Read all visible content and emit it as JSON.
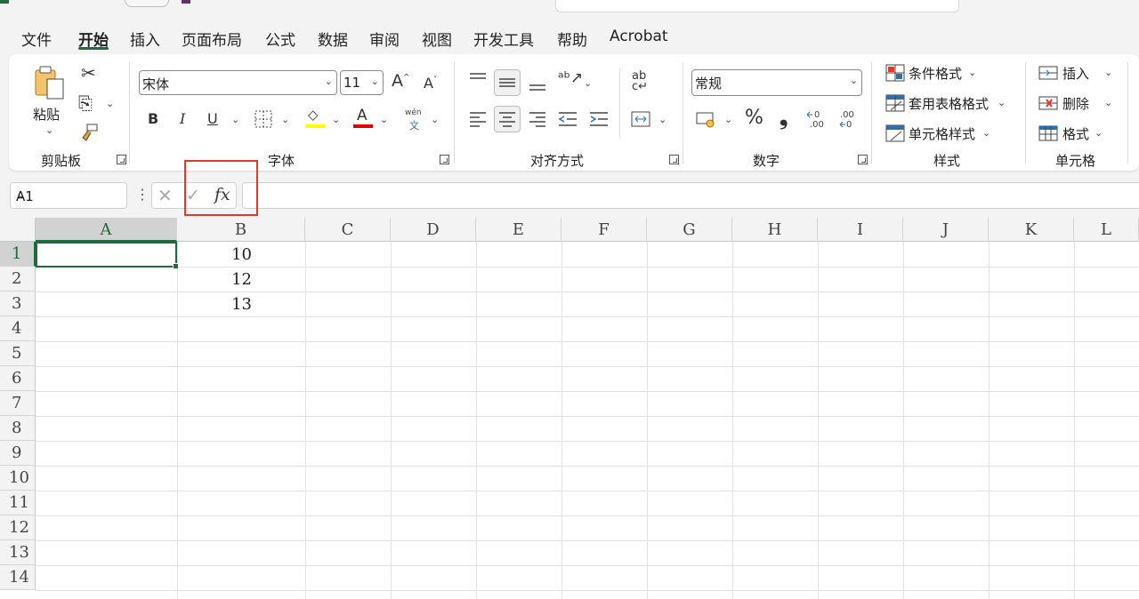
{
  "menu": {
    "tabs": [
      "文件",
      "开始",
      "插入",
      "页面布局",
      "公式",
      "数据",
      "审阅",
      "视图",
      "开发工具",
      "帮助",
      "Acrobat"
    ],
    "active": "开始"
  },
  "ribbon": {
    "clipboard": {
      "paste_label": "粘贴",
      "group_label": "剪贴板"
    },
    "font": {
      "font_name": "宋体",
      "font_size": "11",
      "group_label": "字体",
      "bold": "B",
      "italic": "I",
      "underline": "U",
      "phonetic_top": "wén",
      "phonetic_bottom": "文"
    },
    "alignment": {
      "group_label": "对齐方式"
    },
    "number": {
      "format": "常规",
      "group_label": "数字",
      "percent": "%",
      "comma": "9",
      "inc_decimal": "←0\n.00",
      "dec_decimal": ".00\n→0"
    },
    "styles": {
      "conditional": "条件格式",
      "table": "套用表格格式",
      "cell_styles": "单元格样式",
      "group_label": "样式"
    },
    "cells": {
      "insert": "插入",
      "delete": "删除",
      "format": "格式",
      "group_label": "单元格"
    }
  },
  "formula_bar": {
    "name_box": "A1",
    "fx": "fx",
    "formula": ""
  },
  "sheet": {
    "columns": [
      "A",
      "B",
      "C",
      "D",
      "E",
      "F",
      "G",
      "H",
      "I",
      "J",
      "K",
      "L"
    ],
    "rows": [
      "1",
      "2",
      "3",
      "4",
      "5",
      "6",
      "7",
      "8",
      "9",
      "10",
      "11",
      "12",
      "13",
      "14"
    ],
    "selected_cell": "A1",
    "cells": {
      "B1": "10",
      "B2": "12",
      "B3": "13"
    }
  },
  "colors": {
    "accent": "#1e6b3c",
    "highlight_box": "#e0382b",
    "fill_yellow": "#ffff00",
    "font_red": "#e00000"
  }
}
